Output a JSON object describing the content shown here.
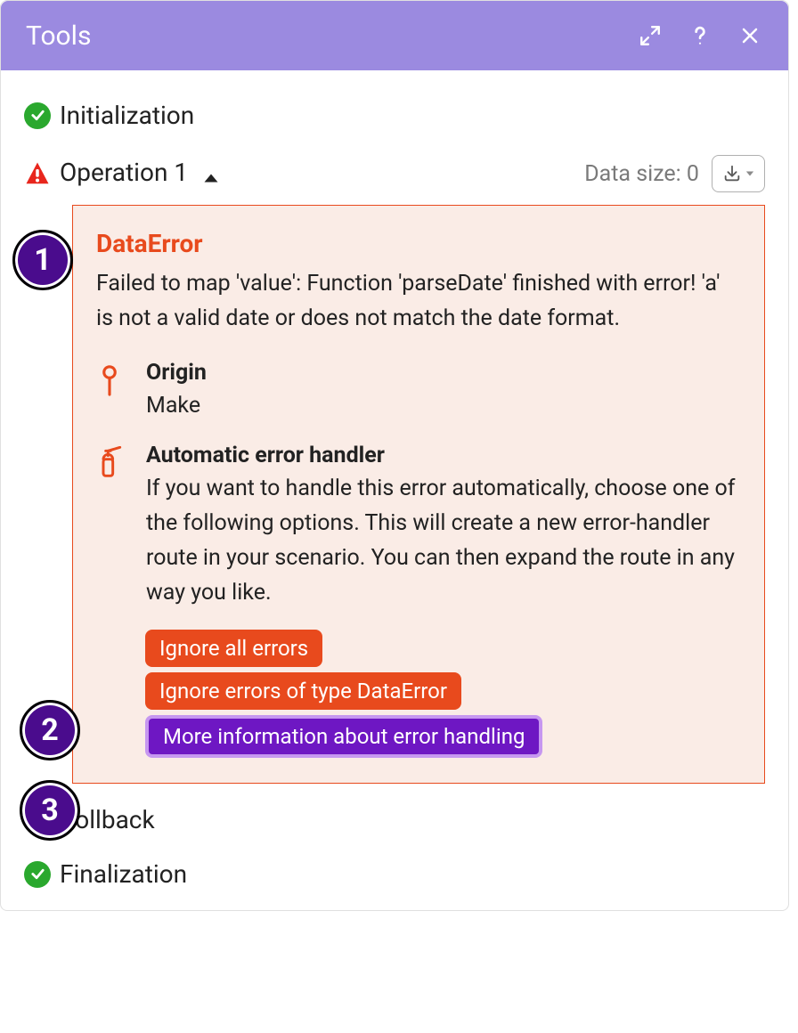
{
  "header": {
    "title": "Tools"
  },
  "steps": {
    "initialization": "Initialization",
    "operation": "Operation 1",
    "data_size_label": "Data size: 0",
    "rollback": "Rollback",
    "finalization": "Finalization"
  },
  "error": {
    "title": "DataError",
    "message": "Failed to map 'value': Function 'parseDate' finished with error! 'a' is not a valid date or does not match the date format.",
    "origin_label": "Origin",
    "origin_value": "Make",
    "handler_title": "Automatic error handler",
    "handler_text": "If you want to handle this error automatically, choose one of the following options. This will create a new error-handler route in your scenario. You can then expand the route in any way you like.",
    "buttons": {
      "ignore_all": "Ignore all errors",
      "ignore_type": "Ignore errors of type DataError",
      "more_info": "More information about error handling"
    }
  },
  "callouts": {
    "c1": "1",
    "c2": "2",
    "c3": "3"
  }
}
